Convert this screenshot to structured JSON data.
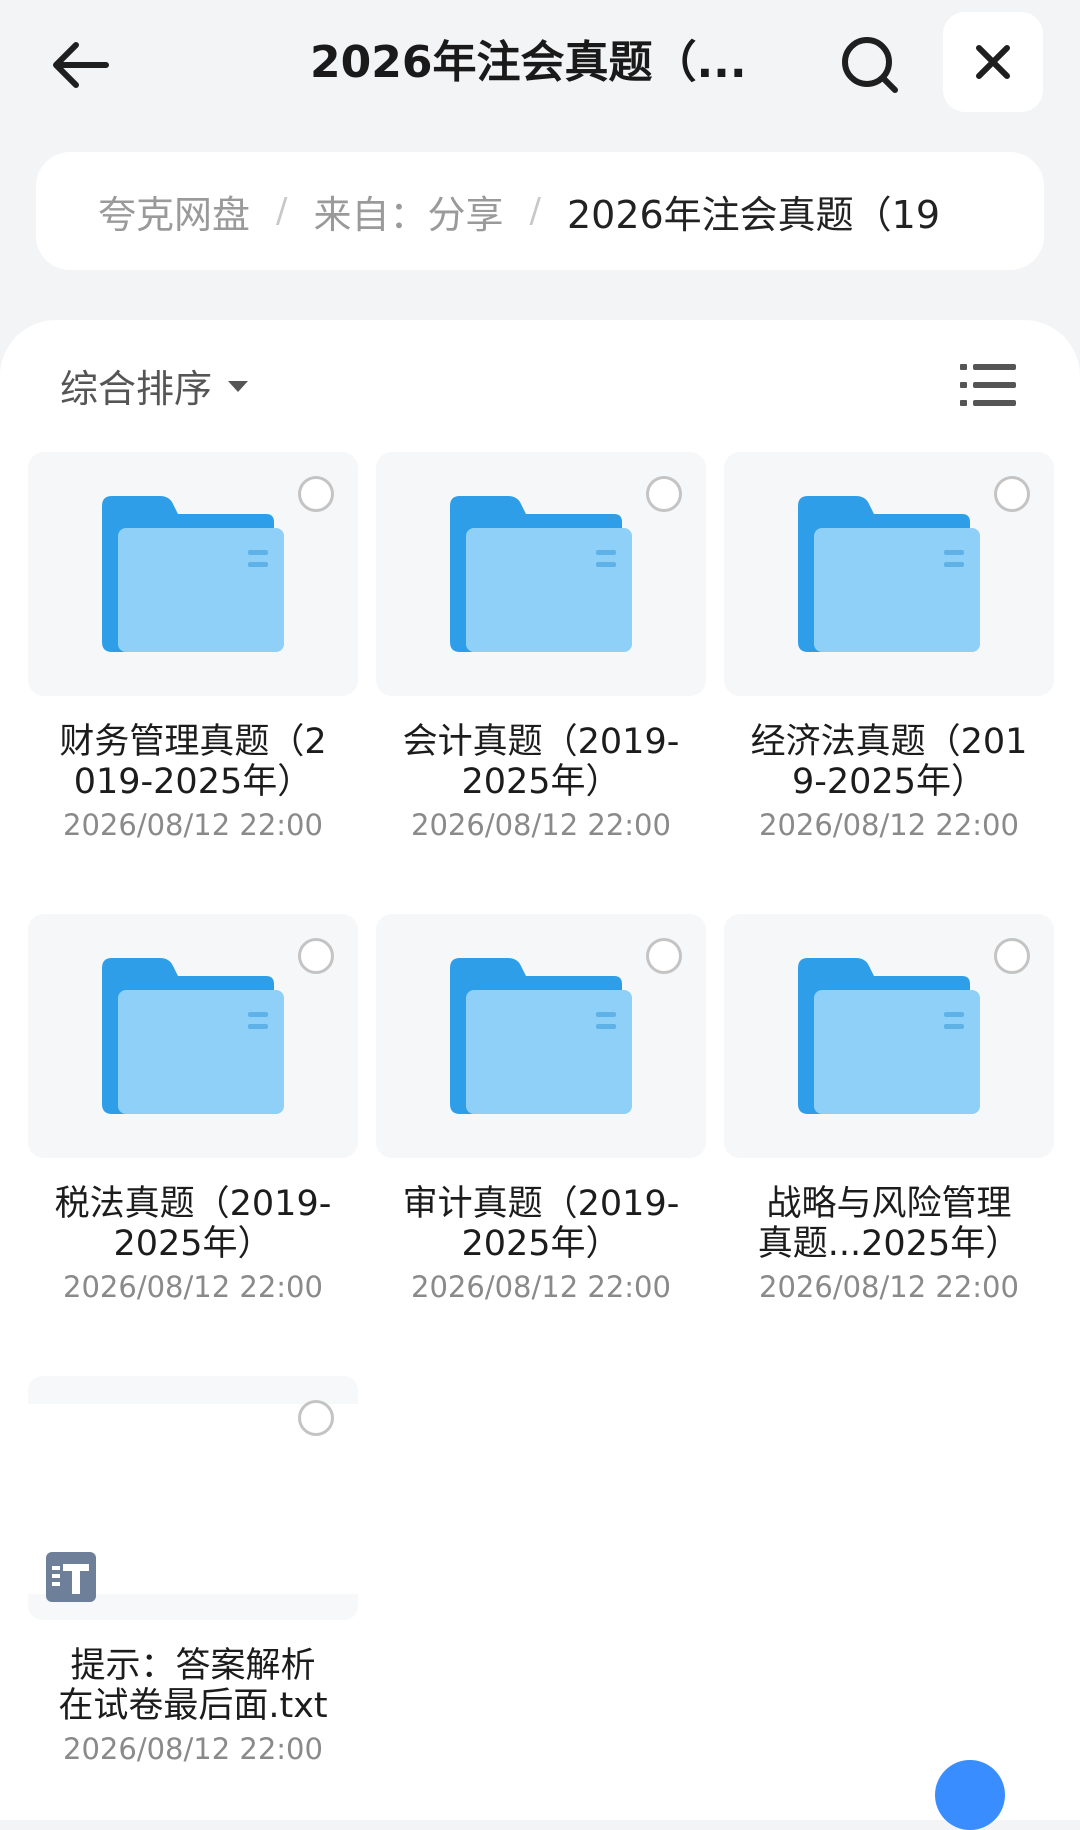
{
  "header": {
    "title": "2026年注会真题（..."
  },
  "breadcrumb": {
    "items": [
      "夸克网盘",
      "来自：分享"
    ],
    "current": "2026年注会真题（19",
    "separator": "/"
  },
  "toolbar": {
    "sort_label": "综合排序"
  },
  "items": [
    {
      "type": "folder",
      "name_lines": [
        "财务管理真题（2",
        "019-2025年）"
      ],
      "date": "2026/08/12 22:00"
    },
    {
      "type": "folder",
      "name_lines": [
        "会计真题（2019-",
        "2025年）"
      ],
      "date": "2026/08/12 22:00"
    },
    {
      "type": "folder",
      "name_lines": [
        "经济法真题（201",
        "9-2025年）"
      ],
      "date": "2026/08/12 22:00"
    },
    {
      "type": "folder",
      "name_lines": [
        "税法真题（2019-",
        "2025年）"
      ],
      "date": "2026/08/12 22:00"
    },
    {
      "type": "folder",
      "name_lines": [
        "审计真题（2019-",
        "2025年）"
      ],
      "date": "2026/08/12 22:00"
    },
    {
      "type": "folder",
      "name_lines": [
        "战略与风险管理",
        "真题...2025年）"
      ],
      "date": "2026/08/12 22:00"
    },
    {
      "type": "txt",
      "name_lines": [
        "提示：答案解析",
        "在试卷最后面.txt"
      ],
      "date": "2026/08/12 22:00"
    }
  ],
  "colors": {
    "folder_back": "#2f9ee8",
    "folder_front": "#8fd0f8",
    "accent": "#3a8dff",
    "txt_icon": "#6d7f99"
  },
  "icons": [
    "back-arrow-icon",
    "search-icon",
    "close-icon",
    "list-view-icon",
    "folder-icon",
    "txt-file-icon",
    "dropdown-caret-icon"
  ]
}
